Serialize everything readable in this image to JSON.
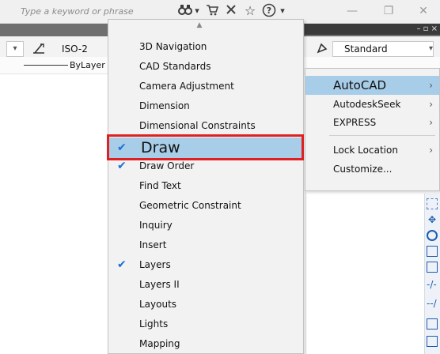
{
  "search": {
    "placeholder": "Type a keyword or phrase"
  },
  "toolbar_icons": [
    "binoculars-icon",
    "cart-icon",
    "x-icon",
    "star-icon",
    "help-icon"
  ],
  "ribbon": {
    "dimstyle": "ISO-2",
    "textstyle": "Standard",
    "layer": "ByLayer"
  },
  "toolbars_menu": {
    "items": [
      {
        "label": "3D Navigation",
        "checked": false
      },
      {
        "label": "CAD Standards",
        "checked": false
      },
      {
        "label": "Camera Adjustment",
        "checked": false
      },
      {
        "label": "Dimension",
        "checked": false
      },
      {
        "label": "Dimensional Constraints",
        "checked": false
      },
      {
        "label": "Draw",
        "checked": true,
        "highlighted": true
      },
      {
        "label": "Draw Order",
        "checked": true
      },
      {
        "label": "Find Text",
        "checked": false
      },
      {
        "label": "Geometric Constraint",
        "checked": false
      },
      {
        "label": "Inquiry",
        "checked": false
      },
      {
        "label": "Insert",
        "checked": false
      },
      {
        "label": "Layers",
        "checked": true
      },
      {
        "label": "Layers II",
        "checked": false
      },
      {
        "label": "Layouts",
        "checked": false
      },
      {
        "label": "Lights",
        "checked": false
      },
      {
        "label": "Mapping",
        "checked": false
      }
    ]
  },
  "context_menu": {
    "items": [
      {
        "label": "AutoCAD",
        "submenu": true,
        "highlighted": true
      },
      {
        "label": "AutodeskSeek",
        "submenu": true
      },
      {
        "label": "EXPRESS",
        "submenu": true
      },
      {
        "label": "Lock Location",
        "submenu": true
      },
      {
        "label": "Customize...",
        "submenu": false
      }
    ]
  },
  "colors": {
    "highlight": "#a8cde8",
    "annotation_red": "#e02020",
    "check": "#1a6fd1"
  }
}
